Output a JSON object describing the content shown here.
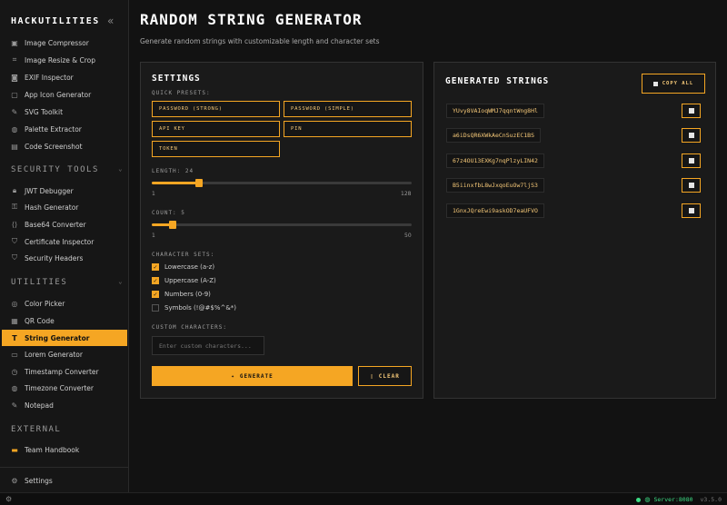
{
  "app": {
    "brand": "HACKUTILITIES",
    "collapse_icon": "chevrons-left"
  },
  "sidebar": {
    "top_items": [
      {
        "label": "Image Compressor",
        "icon": "image-icon"
      },
      {
        "label": "Image Resize & Crop",
        "icon": "crop-icon"
      },
      {
        "label": "EXIF Inspector",
        "icon": "camera-icon"
      },
      {
        "label": "App Icon Generator",
        "icon": "app-icon"
      },
      {
        "label": "SVG Toolkit",
        "icon": "pen-icon"
      },
      {
        "label": "Palette Extractor",
        "icon": "palette-icon"
      },
      {
        "label": "Code Screenshot",
        "icon": "screenshot-icon"
      }
    ],
    "security": {
      "title": "SECURITY TOOLS",
      "items": [
        {
          "label": "JWT Debugger",
          "icon": "lock-icon"
        },
        {
          "label": "Hash Generator",
          "icon": "hash-icon"
        },
        {
          "label": "Base64 Converter",
          "icon": "code-icon"
        },
        {
          "label": "Certificate Inspector",
          "icon": "shield-icon"
        },
        {
          "label": "Security Headers",
          "icon": "shield-icon"
        }
      ]
    },
    "utilities": {
      "title": "UTILITIES",
      "items": [
        {
          "label": "Color Picker",
          "icon": "dropper-icon"
        },
        {
          "label": "QR Code",
          "icon": "qr-icon"
        },
        {
          "label": "String Generator",
          "icon": "text-icon",
          "active": true
        },
        {
          "label": "Lorem Generator",
          "icon": "document-icon"
        },
        {
          "label": "Timestamp Converter",
          "icon": "clock-icon"
        },
        {
          "label": "Timezone Converter",
          "icon": "globe-icon"
        },
        {
          "label": "Notepad",
          "icon": "note-icon"
        }
      ]
    },
    "external": {
      "title": "EXTERNAL",
      "items": [
        {
          "label": "Team Handbook",
          "icon": "book-icon"
        }
      ]
    },
    "footer": {
      "label": "Settings",
      "icon": "gear-icon"
    }
  },
  "status": {
    "server": "Server:8080",
    "version": "v3.5.0"
  },
  "main": {
    "title": "RANDOM STRING GENERATOR",
    "subtitle": "Generate random strings with customizable length and character sets"
  },
  "settings": {
    "title": "SETTINGS",
    "presets_label": "QUICK PRESETS:",
    "presets": [
      "PASSWORD (STRONG)",
      "PASSWORD (SIMPLE)",
      "API KEY",
      "PIN",
      "TOKEN"
    ],
    "length": {
      "label": "LENGTH: 24",
      "value": 24,
      "min": 1,
      "max": 128,
      "min_label": "1",
      "max_label": "128"
    },
    "count": {
      "label": "COUNT: 5",
      "value": 5,
      "min": 1,
      "max": 50,
      "min_label": "1",
      "max_label": "50"
    },
    "charsets_label": "CHARACTER SETS:",
    "charsets": [
      {
        "label": "Lowercase (a-z)",
        "checked": true
      },
      {
        "label": "Uppercase (A-Z)",
        "checked": true
      },
      {
        "label": "Numbers (0-9)",
        "checked": true
      },
      {
        "label": "Symbols (!@#$%^&*)",
        "checked": false
      }
    ],
    "custom_label": "CUSTOM CHARACTERS:",
    "custom_placeholder": "Enter custom characters...",
    "generate_label": "GENERATE",
    "clear_label": "CLEAR"
  },
  "results": {
    "title": "GENERATED STRINGS",
    "copy_all_label": "COPY ALL",
    "strings": [
      "YUvy8VAIoqWMJ7qqntWng8Hl",
      "a6iDsQR6XWkAeCnSuzEC1BS",
      "67z4OU13EXKg7nqPlzyLIN42",
      "B5iinxfbL8wJxqoEuOw7ljS3",
      "1GnxJQreEwi9askOD7eaUFVO"
    ]
  },
  "colors": {
    "accent": "#f5a623",
    "bg": "#121212",
    "panel": "#1a1a1a",
    "online": "#3ddc84"
  }
}
